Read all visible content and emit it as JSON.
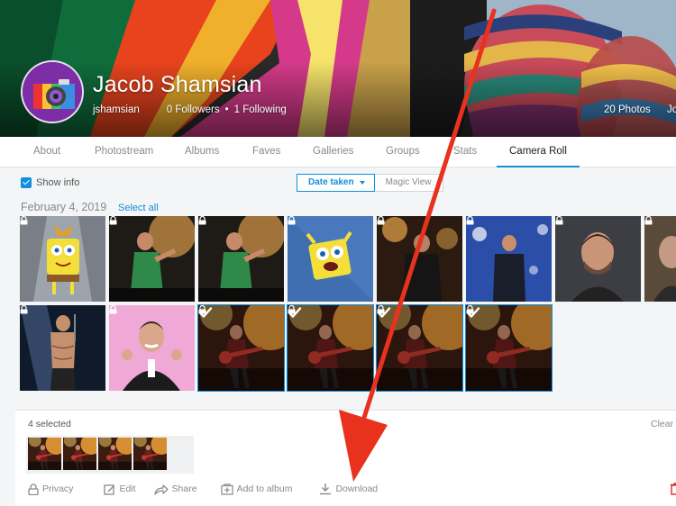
{
  "profile": {
    "name": "Jacob Shamsian",
    "username": "jshamsian",
    "followers": "0 Followers",
    "separator": "•",
    "following": "1 Following",
    "photos": "20 Photos",
    "joined": "Jo"
  },
  "nav": {
    "tabs": [
      {
        "label": "About"
      },
      {
        "label": "Photostream"
      },
      {
        "label": "Albums"
      },
      {
        "label": "Faves"
      },
      {
        "label": "Galleries"
      },
      {
        "label": "Groups"
      },
      {
        "label": "Stats"
      },
      {
        "label": "Camera Roll",
        "active": true
      }
    ]
  },
  "toolbar": {
    "show_info": "Show info",
    "date_taken": "Date taken",
    "magic_view": "Magic View"
  },
  "section": {
    "date": "February 4, 2019",
    "select_all": "Select all"
  },
  "selection": {
    "count_label": "4 selected",
    "clear": "Clear",
    "actions": {
      "privacy": "Privacy",
      "edit": "Edit",
      "share": "Share",
      "add_to_album": "Add to album",
      "download": "Download"
    }
  },
  "colors": {
    "accent": "#128fdc",
    "annotation_arrow": "#e8321e"
  },
  "icons": {
    "lock": "lock-icon",
    "check": "check-icon",
    "download": "download-icon",
    "trash": "trash-icon"
  }
}
